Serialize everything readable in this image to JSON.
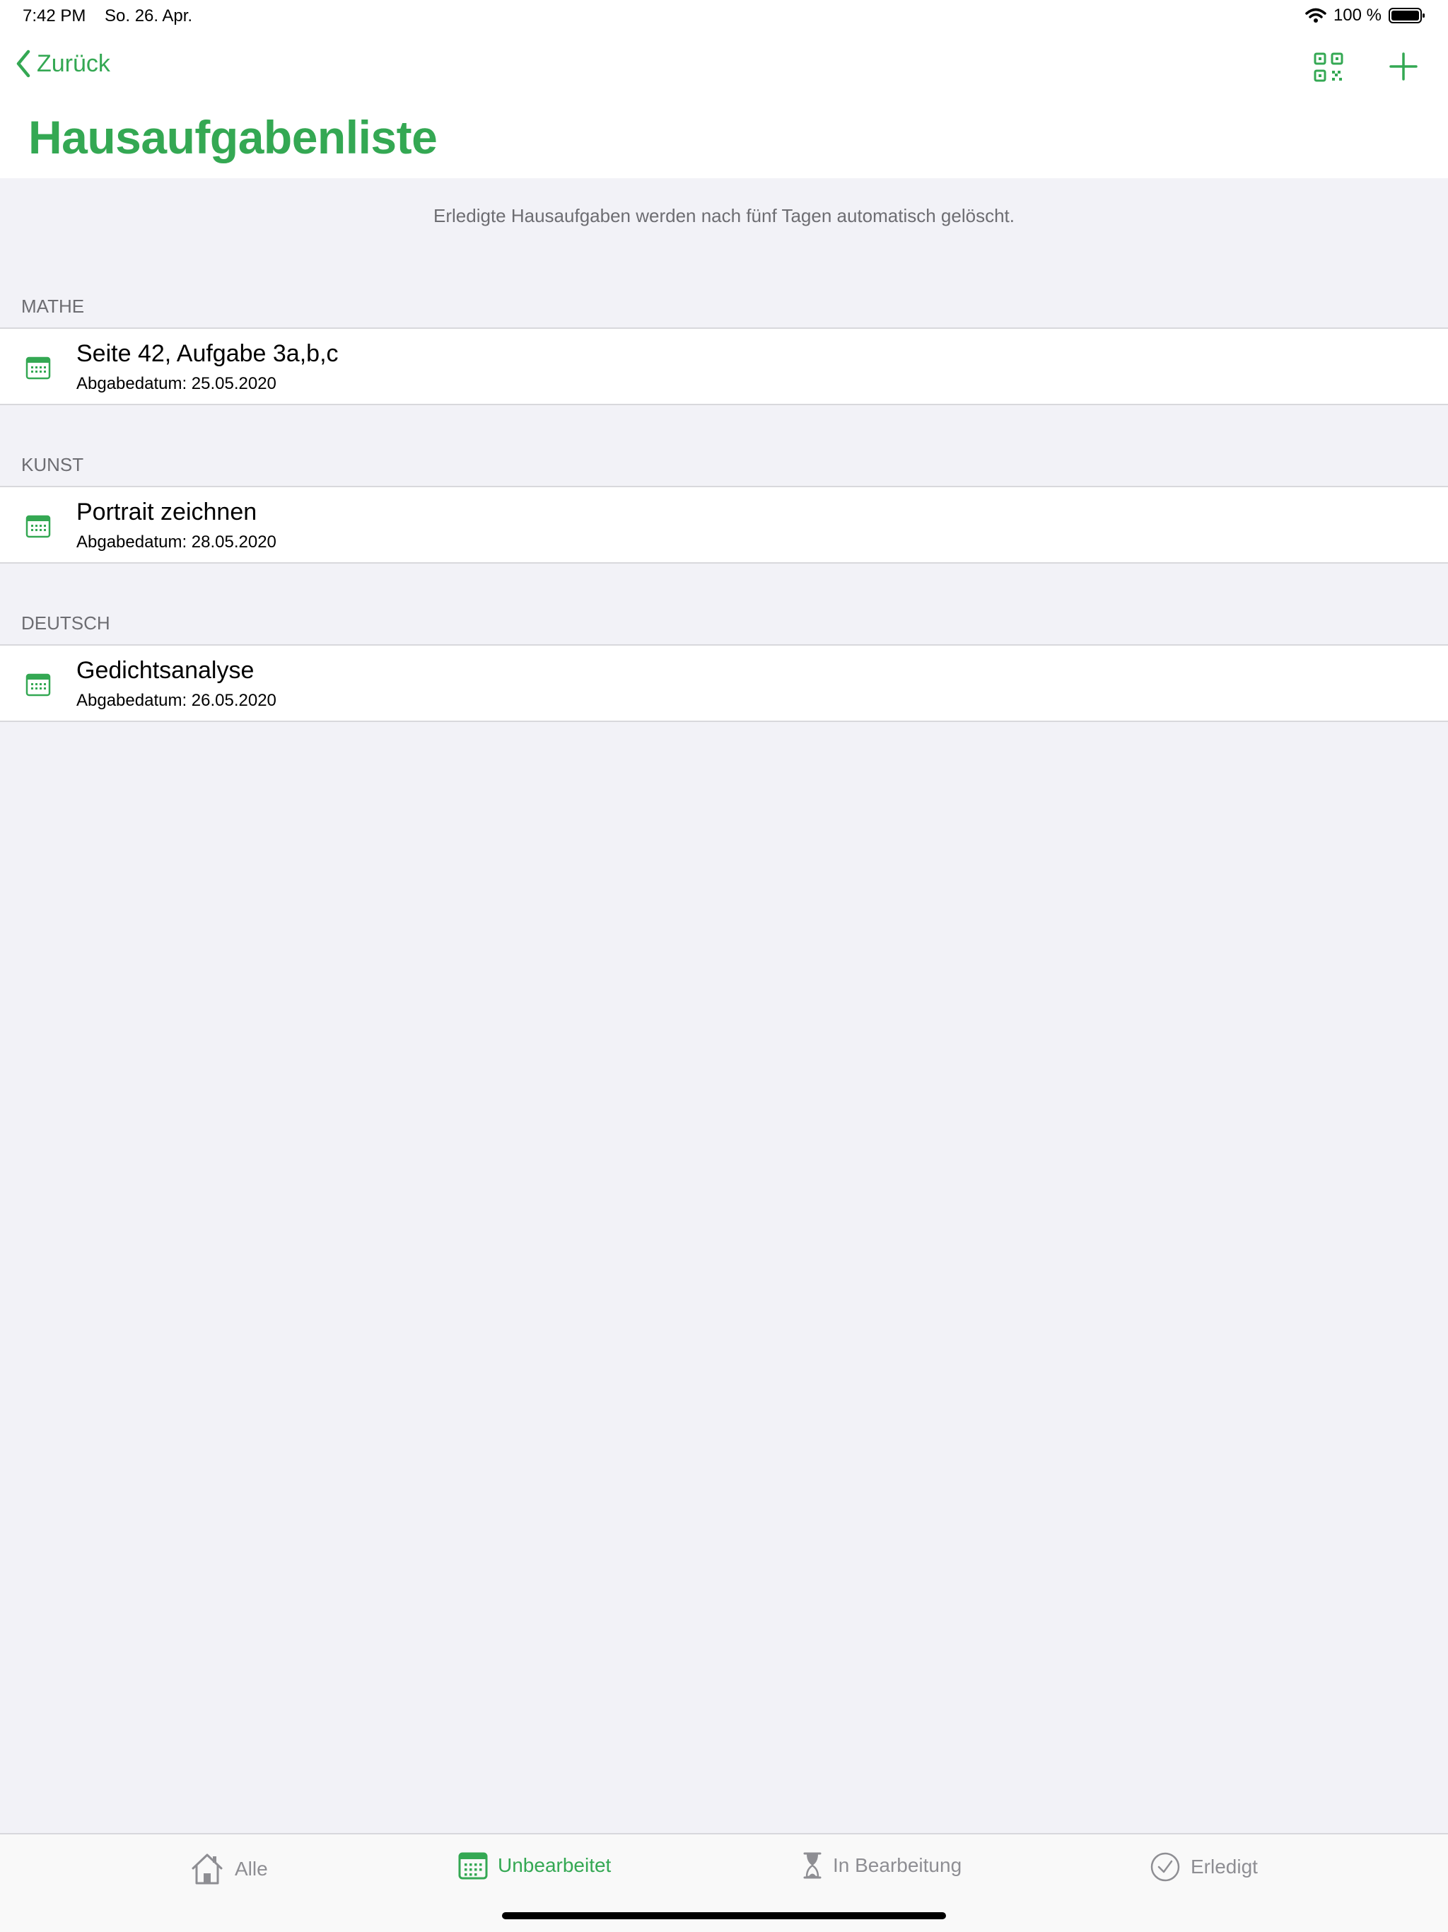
{
  "status": {
    "time": "7:42 PM",
    "date": "So. 26. Apr.",
    "battery": "100 %"
  },
  "nav": {
    "back_label": "Zurück",
    "title": "Hausaufgabenliste"
  },
  "info": "Erledigte Hausaufgaben werden nach fünf Tagen automatisch gelöscht.",
  "sections": [
    {
      "header": "MATHE",
      "item": {
        "title": "Seite 42, Aufgabe 3a,b,c",
        "subtitle": "Abgabedatum: 25.05.2020"
      }
    },
    {
      "header": "KUNST",
      "item": {
        "title": "Portrait zeichnen",
        "subtitle": "Abgabedatum: 28.05.2020"
      }
    },
    {
      "header": "DEUTSCH",
      "item": {
        "title": "Gedichtsanalyse",
        "subtitle": "Abgabedatum: 26.05.2020"
      }
    }
  ],
  "tabs": [
    {
      "label": "Alle",
      "icon": "house-icon"
    },
    {
      "label": "Unbearbeitet",
      "icon": "calendar-icon",
      "active": true
    },
    {
      "label": "In Bearbeitung",
      "icon": "hourglass-icon"
    },
    {
      "label": "Erledigt",
      "icon": "checkmark-circle-icon"
    }
  ],
  "colors": {
    "accent": "#34a853",
    "background": "#f2f2f7",
    "secondary_text": "#6d6d72",
    "inactive_tab": "#8e8e93"
  }
}
